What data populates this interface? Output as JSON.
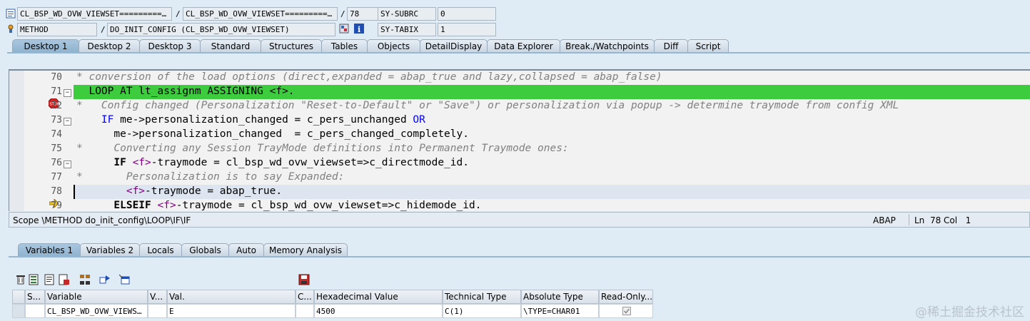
{
  "header": {
    "program": "CL_BSP_WD_OVW_VIEWSET=========…",
    "include": "CL_BSP_WD_OVW_VIEWSET=========…",
    "line": "78",
    "sep1": "/",
    "sep2": "/",
    "sep3": "/",
    "event_type": "METHOD",
    "event": "DO_INIT_CONFIG (CL_BSP_WD_OVW_VIEWSET)",
    "sysvars": [
      {
        "name": "SY-SUBRC",
        "value": "0"
      },
      {
        "name": "SY-TABIX",
        "value": "1"
      }
    ]
  },
  "desktop_tabs": [
    "Desktop 1",
    "Desktop 2",
    "Desktop 3",
    "Standard",
    "Structures",
    "Tables",
    "Objects",
    "DetailDisplay",
    "Data Explorer",
    "Break./Watchpoints",
    "Diff",
    "Script"
  ],
  "active_desktop_tab": "Desktop 1",
  "code": {
    "line_numbers": [
      "70",
      "71",
      "72",
      "73",
      "74",
      "75",
      "76",
      "77",
      "78",
      "79"
    ],
    "l70": "* conversion of the load options (direct,expanded = abap_true and lazy,collapsed = abap_false)",
    "l71": "  LOOP AT lt_assignm ASSIGNING <f>.",
    "l72": "*   Config changed (Personalization \"Reset-to-Default\" or \"Save\") or personalization via popup -> determine traymode from config XML",
    "l73_a": "    IF",
    "l73_b": " me->personalization_changed = c_pers_unchanged ",
    "l73_c": "OR",
    "l74": "      me->personalization_changed  = c_pers_changed_completely.",
    "l75": "*     Converting any Session TrayMode definitions into Permanent Traymode ones:",
    "l76_a": "      IF",
    "l76_b": " <f>",
    "l76_c": "-traymode = cl_bsp_wd_ovw_viewset=>c_directmode_id.",
    "l77": "*       Personalization is to say Expanded:",
    "l78_a": "        <f>",
    "l78_b": "-traymode = abap_true.",
    "l79_a": "      ELSEIF",
    "l79_b": " <f>",
    "l79_c": "-traymode = cl_bsp_wd_ovw_viewset=>c_hidemode_id.",
    "breakpoint_line": "71",
    "current_line": "78",
    "colors": {
      "breakpoint_highlight": "#3dcc3d",
      "current_line": "#dde6f0"
    }
  },
  "status_bar": {
    "scope": "Scope \\METHOD do_init_config\\LOOP\\IF\\IF",
    "language": "ABAP",
    "ln_label": "Ln",
    "ln": "78",
    "col_label": "Col",
    "col": "1"
  },
  "var_tabs": [
    "Variables 1",
    "Variables 2",
    "Locals",
    "Globals",
    "Auto",
    "Memory Analysis"
  ],
  "active_var_tab": "Variables 1",
  "var_table": {
    "headers": [
      "S...",
      "Variable",
      "V...",
      "Val.",
      "C...",
      "Hexadecimal Value",
      "Technical Type",
      "Absolute Type",
      "Read-Only..."
    ],
    "rows": [
      {
        "variable": "CL_BSP_WD_OVW_VIEWS…",
        "val": "E",
        "hex": "4500",
        "tech_type": "C(1)",
        "abs_type": "\\TYPE=CHAR01",
        "read_only": true
      }
    ]
  },
  "watermark": "@稀土掘金技术社区"
}
